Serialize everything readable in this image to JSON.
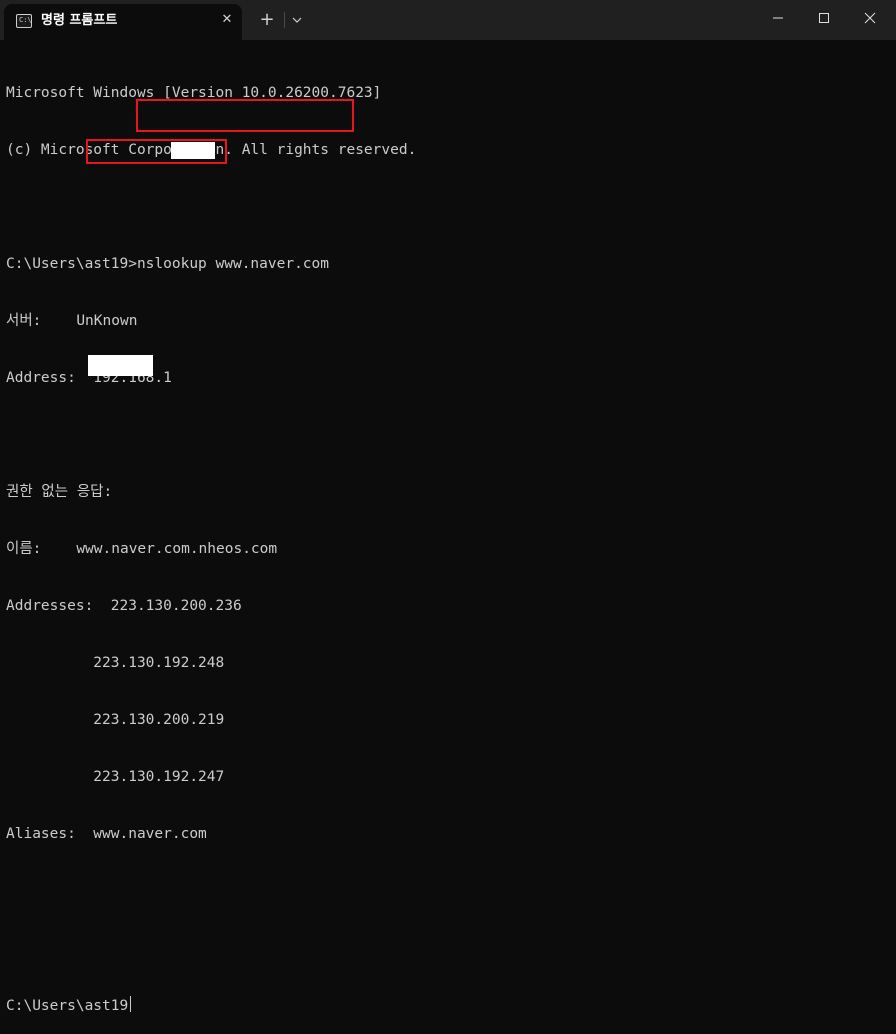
{
  "window": {
    "tab_title": "명령 프롬프트",
    "tab_icon": "cmd-icon",
    "tab_icon_glyph": "C:\\",
    "close_tab_glyph": "✕",
    "new_tab_glyph": "+"
  },
  "terminal": {
    "lines": [
      "Microsoft Windows [Version 10.0.26200.7623]",
      "(c) Microsoft Corporation. All rights reserved.",
      "",
      "C:\\Users\\ast19>nslookup www.naver.com",
      "서버:    UnKnown",
      "Address:  192.168.1",
      "",
      "권한 없는 응답:",
      "이름:    www.naver.com.nheos.com",
      "Addresses:  223.130.200.236",
      "          223.130.192.248",
      "          223.130.200.219",
      "          223.130.192.247",
      "Aliases:  www.naver.com",
      "",
      "",
      "C:\\Users\\ast19"
    ]
  },
  "colors": {
    "terminal_bg": "#0c0c0c",
    "titlebar_bg": "#202020",
    "text": "#cccccc",
    "highlight_border": "#e8141f",
    "redaction": "#ffffff"
  }
}
